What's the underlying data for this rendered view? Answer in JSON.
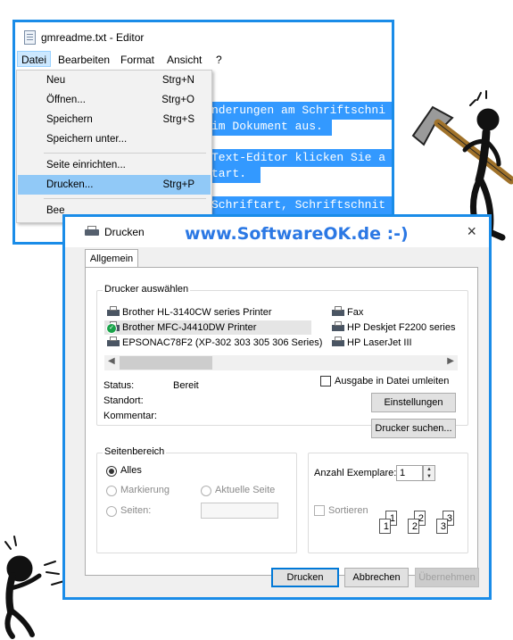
{
  "editor": {
    "title": "gmreadme.txt - Editor",
    "menu": [
      "Datei",
      "Bearbeiten",
      "Format",
      "Ansicht",
      "?"
    ],
    "lines": [
      "nderungen am Schriftschni",
      "im Dokument aus.",
      "Text-Editor klicken Sie a",
      "tart.",
      "Schriftart, Schriftschnit"
    ]
  },
  "dropdown": {
    "items": [
      {
        "label": "Neu",
        "shortcut": "Strg+N"
      },
      {
        "label": "Öffnen...",
        "shortcut": "Strg+O"
      },
      {
        "label": "Speichern",
        "shortcut": "Strg+S"
      },
      {
        "label": "Speichern unter...",
        "shortcut": ""
      },
      {
        "label": "Seite einrichten...",
        "shortcut": ""
      },
      {
        "label": "Drucken...",
        "shortcut": "Strg+P"
      },
      {
        "label": "Bee",
        "shortcut": ""
      }
    ]
  },
  "dialog": {
    "title": "Drucken",
    "brand": "www.SoftwareOK.de :-)",
    "close_icon": "×",
    "tab": "Allgemein",
    "select_printer_label": "Drucker auswählen",
    "printers": [
      "Brother HL-3140CW series Printer",
      "Brother MFC-J4410DW Printer",
      "EPSONAC78F2 (XP-302 303 305 306 Series)",
      "Fax",
      "HP Deskjet F2200 series",
      "HP LaserJet III"
    ],
    "status_label": "Status:",
    "status_value": "Bereit",
    "location_label": "Standort:",
    "comment_label": "Kommentar:",
    "print_to_file": "Ausgabe in Datei umleiten",
    "settings_button": "Einstellungen",
    "find_printer_button": "Drucker suchen...",
    "page_range_label": "Seitenbereich",
    "all_label": "Alles",
    "selection_label": "Markierung",
    "current_page_label": "Aktuelle Seite",
    "pages_label": "Seiten:",
    "copies_label": "Anzahl Exemplare:",
    "copies_value": "1",
    "collate_label": "Sortieren",
    "print_button": "Drucken",
    "cancel_button": "Abbrechen",
    "apply_button": "Übernehmen"
  }
}
